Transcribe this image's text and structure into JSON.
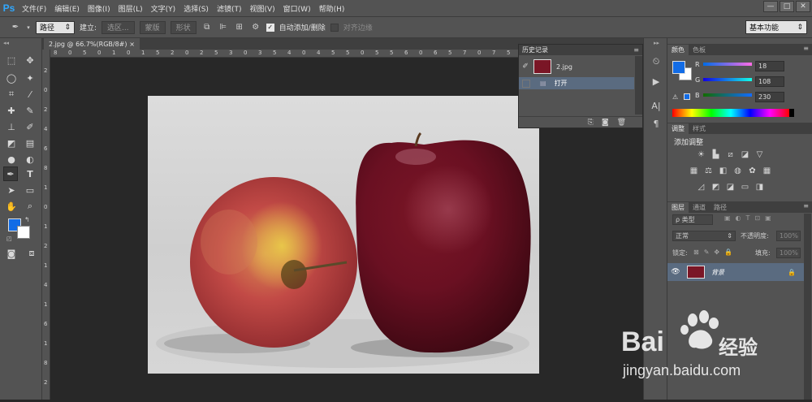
{
  "app": {
    "logo": "Ps"
  },
  "menu": [
    "文件(F)",
    "编辑(E)",
    "图像(I)",
    "图层(L)",
    "文字(Y)",
    "选择(S)",
    "滤镜(T)",
    "视图(V)",
    "窗口(W)",
    "帮助(H)"
  ],
  "window_buttons": [
    "—",
    "□",
    "✕"
  ],
  "options": {
    "tool_mode": "路径",
    "build_label": "建立:",
    "selection_btn": "选区...",
    "mask_btn": "蒙版",
    "shape_btn": "形状",
    "auto_add_label": "自动添加/删除",
    "align_edges_label": "对齐边缘",
    "workspace": "基本功能"
  },
  "document": {
    "tab_title": "2.jpg @ 66.7%(RGB/8#)",
    "tab_close": "×",
    "ruler_h": [
      "8",
      "0",
      "5",
      "0",
      "1",
      "0",
      "1",
      "5",
      "2",
      "0",
      "2",
      "5",
      "3",
      "0",
      "3",
      "5",
      "4",
      "0",
      "4",
      "5",
      "5",
      "0",
      "5",
      "5",
      "6",
      "0",
      "6",
      "5",
      "7",
      "0",
      "7",
      "5",
      "8",
      "0",
      "8",
      "5",
      "9",
      "0",
      "1",
      "0",
      "0"
    ],
    "ruler_v": [
      "2",
      "0",
      "2",
      "4",
      "6",
      "8",
      "1",
      "0",
      "1",
      "2",
      "1",
      "4",
      "1",
      "6",
      "1",
      "8",
      "2"
    ]
  },
  "history": {
    "title": "历史记录",
    "snapshot_name": "2.jpg",
    "step": "打开"
  },
  "color_panel": {
    "tabs": [
      "颜色",
      "色板"
    ],
    "r_label": "R",
    "r": "18",
    "g_label": "G",
    "g": "108",
    "b_label": "B",
    "b": "230",
    "foreground": "#126ce6",
    "background": "#ffffff"
  },
  "adjust_panel": {
    "tabs": [
      "调整",
      "样式"
    ],
    "title": "添加调整"
  },
  "layers_panel": {
    "tabs": [
      "图层",
      "通道",
      "路径"
    ],
    "filter_label": "ρ 类型",
    "blend_mode": "正常",
    "opacity_label": "不透明度:",
    "opacity": "100%",
    "lock_label": "锁定:",
    "fill_label": "填充:",
    "fill": "100%",
    "layer_name": "背景"
  },
  "watermark": {
    "brand": "Bai",
    "brand_cn": "经验",
    "url": "jingyan.baidu.com"
  },
  "colors": {
    "ui_dark": "#535353",
    "ui_darker": "#282828",
    "selection": "#5a6b80",
    "accent": "#31a8ff"
  }
}
